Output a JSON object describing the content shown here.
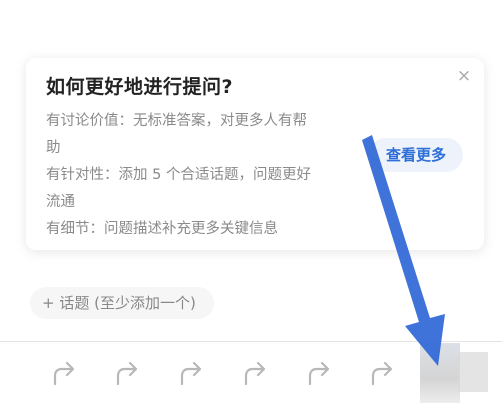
{
  "tips_card": {
    "title": "如何更好地进行提问?",
    "lines": [
      "有讨论价值：无标准答案，对更多人有帮",
      "助",
      " 有针对性：添加 5 个合适话题，问题更好",
      "流通",
      " 有细节：问题描述补充更多关键信息"
    ],
    "close_icon": "×",
    "more_button": "查看更多"
  },
  "topic_chip": "+ 话题 (至少添加一个)",
  "toolbar": {
    "icon_name": "redo-arrow-icon",
    "icon_color": "#b8b8b8"
  },
  "annotation": {
    "arrow_color": "#2f67d6"
  }
}
